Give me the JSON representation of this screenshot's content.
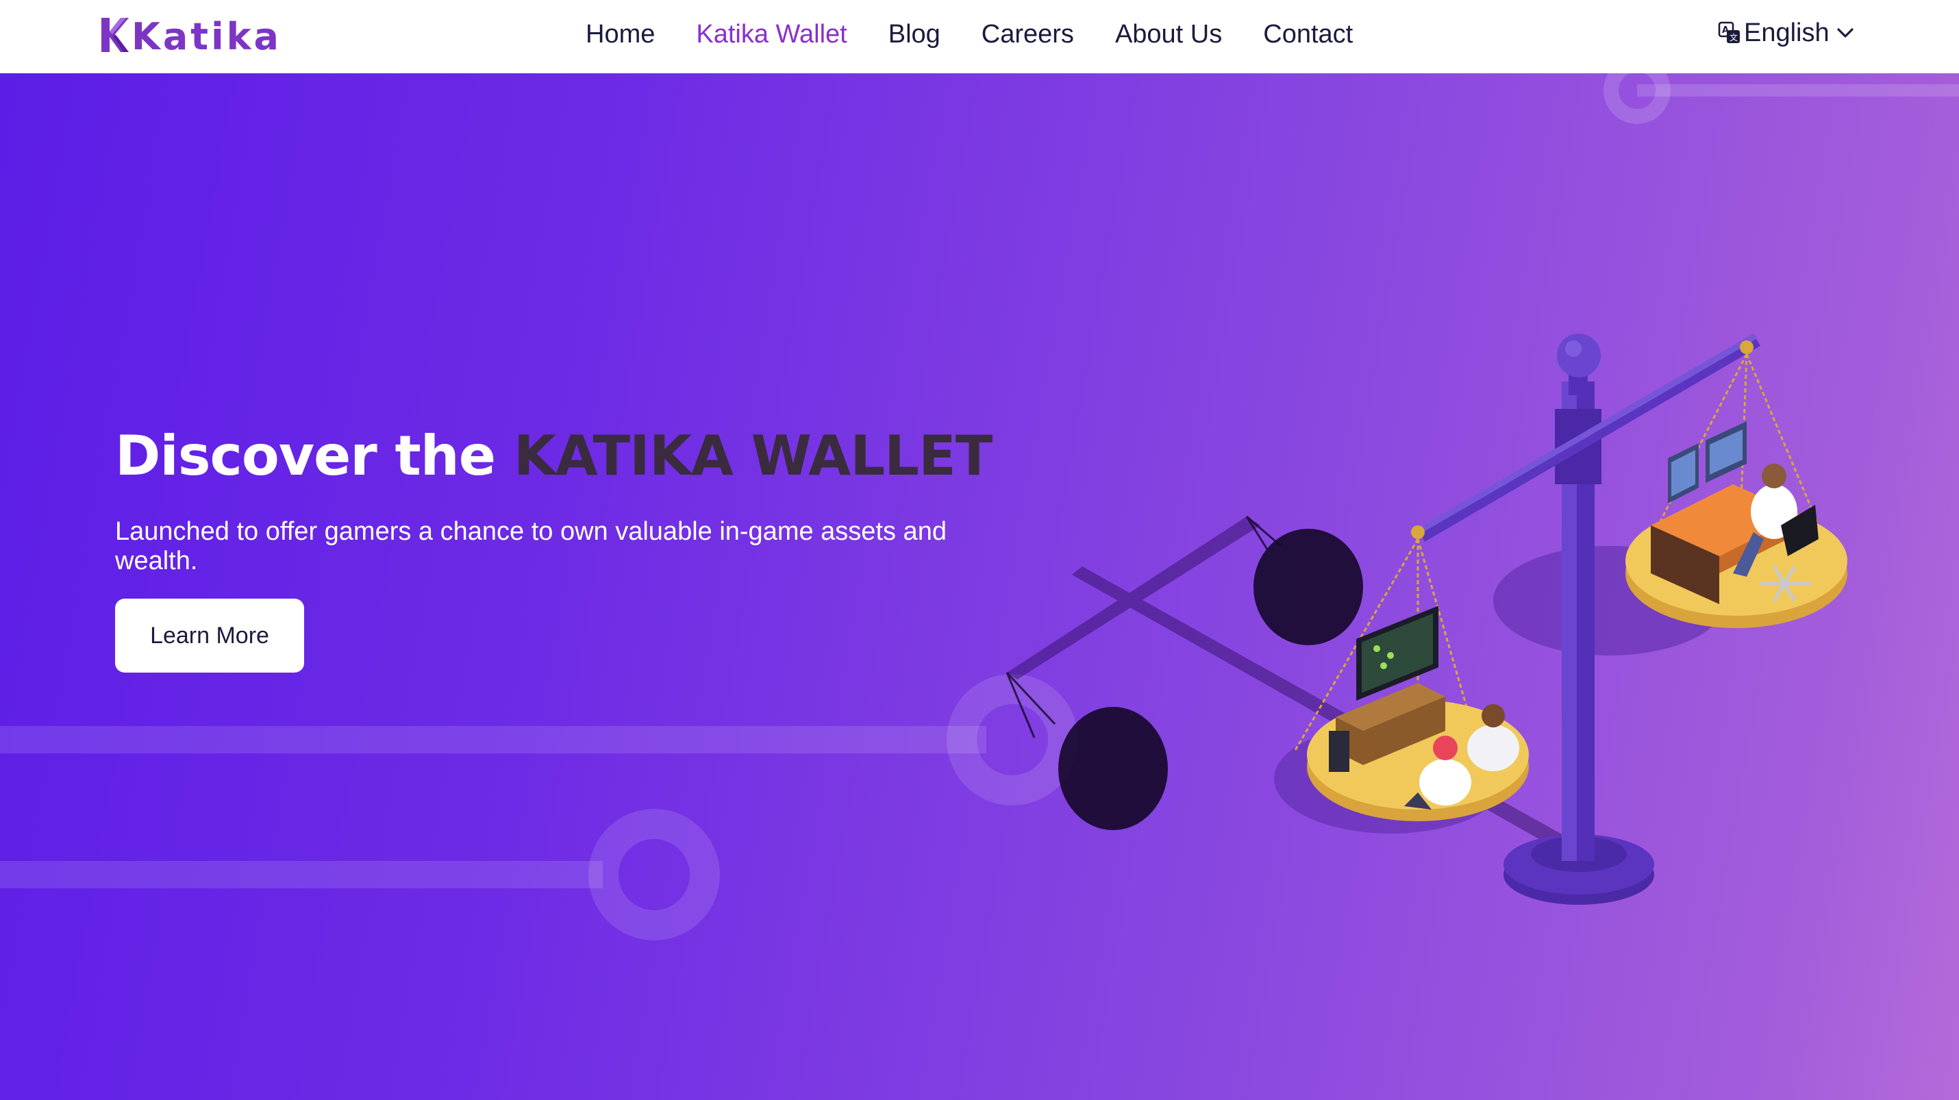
{
  "brand": {
    "name": "Katika",
    "logo_icon": "katika-k-logo",
    "color": "#7d35c5"
  },
  "nav": {
    "items": [
      {
        "label": "Home",
        "active": false
      },
      {
        "label": "Katika Wallet",
        "active": true
      },
      {
        "label": "Blog",
        "active": false
      },
      {
        "label": "Careers",
        "active": false
      },
      {
        "label": "About Us",
        "active": false
      },
      {
        "label": "Contact",
        "active": false
      }
    ],
    "active_color": "#8a2fcf",
    "text_color": "#1a1b3c"
  },
  "language": {
    "label": "English",
    "icon": "translate-icon",
    "chevron": "chevron-down-icon"
  },
  "hero": {
    "title_prefix": "Discover the ",
    "title_accent": "KATIKA WALLET",
    "subtitle": "Launched to offer gamers a chance to own valuable in-game assets and wealth.",
    "cta_label": "Learn More",
    "illustration": "balance-scale-gamers-illustration",
    "gradient": [
      "#5c1de6",
      "#b36ad9"
    ]
  }
}
